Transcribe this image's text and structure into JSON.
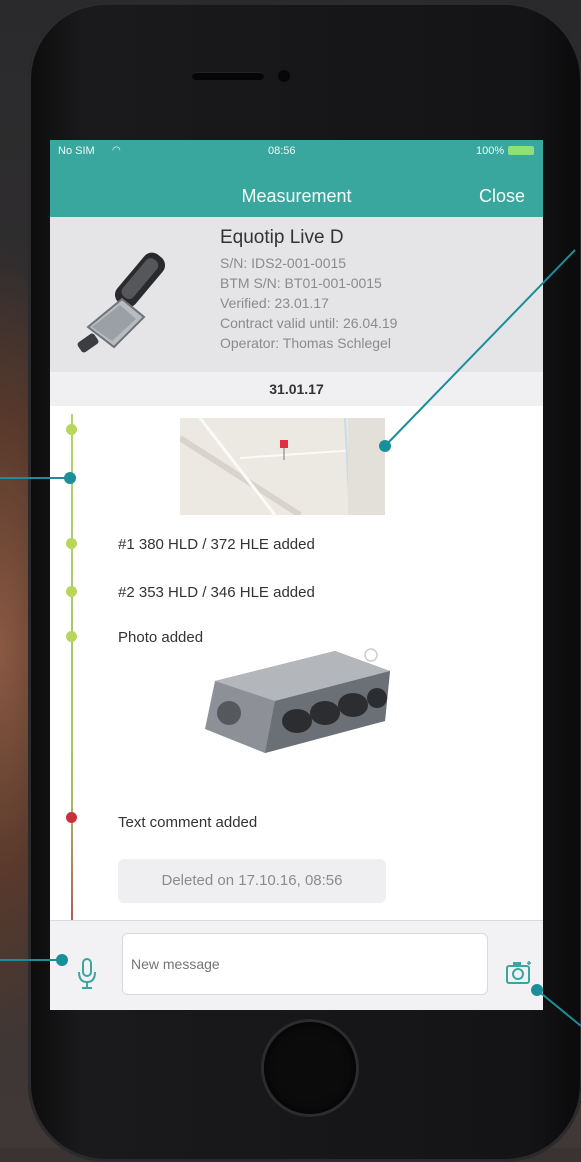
{
  "status_bar": {
    "carrier": "No SIM",
    "time": "08:56",
    "battery": "100%"
  },
  "header": {
    "title": "Measurement",
    "close_label": "Close"
  },
  "device": {
    "name": "Equotip Live D",
    "serial": "S/N: IDS2-001-0015",
    "btm_serial": "BTM S/N: BT01-001-0015",
    "verified": "Verified: 23.01.17",
    "contract": "Contract valid until: 26.04.19",
    "operator": "Operator: Thomas Schlegel",
    "icon": "hardness-tester-probe"
  },
  "timeline": {
    "date": "31.01.17",
    "events": [
      {
        "type": "map"
      },
      {
        "type": "measurement",
        "text": "#1 380 HLD / 372 HLE added"
      },
      {
        "type": "measurement",
        "text": "#2 353 HLD / 346 HLE added"
      },
      {
        "type": "photo",
        "text": "Photo added",
        "image": "engine-block"
      },
      {
        "type": "comment",
        "text": "Text comment added",
        "deleted": "Deleted on 17.10.16, 08:56"
      }
    ]
  },
  "composer": {
    "placeholder": "New message"
  },
  "colors": {
    "accent": "#3aa79f",
    "timeline_green": "#b7d65b",
    "timeline_red": "#c8323f"
  }
}
